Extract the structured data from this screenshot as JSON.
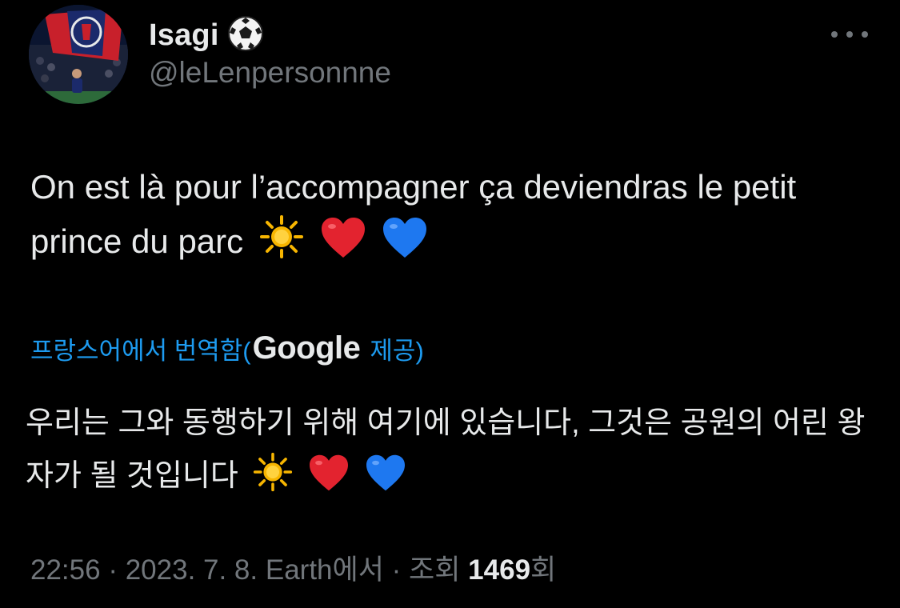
{
  "author": {
    "display_name": "Isagi",
    "name_emoji_icon": "soccer-ball-icon",
    "handle": "@leLenpersonnne"
  },
  "more_menu_icon": "more-horizontal-icon",
  "tweet": {
    "text": "On est là pour l’accompagner ça deviendras le petit prince du parc",
    "emojis": [
      "sun-icon",
      "red-heart-icon",
      "blue-heart-icon"
    ]
  },
  "translation": {
    "label_prefix": "프랑스어에서 번역함(",
    "provider": "Google",
    "label_suffix": " 제공)",
    "text": "우리는 그와 동행하기 위해 여기에 있습니다, 그것은 공원의 어린 왕자가 될 것입니다"
  },
  "meta": {
    "time": "22:56",
    "separator": " · ",
    "date": "2023. 7. 8.",
    "source": "Earth에서",
    "views_label": "조회",
    "views_count": "1469",
    "views_suffix": "회"
  },
  "colors": {
    "background": "#000000",
    "text_primary": "#e7e9ea",
    "text_secondary": "#71767b",
    "link": "#1d9bf0",
    "heart_red": "#e3232f",
    "heart_blue": "#1e78f0",
    "sun": "#f7b500"
  }
}
